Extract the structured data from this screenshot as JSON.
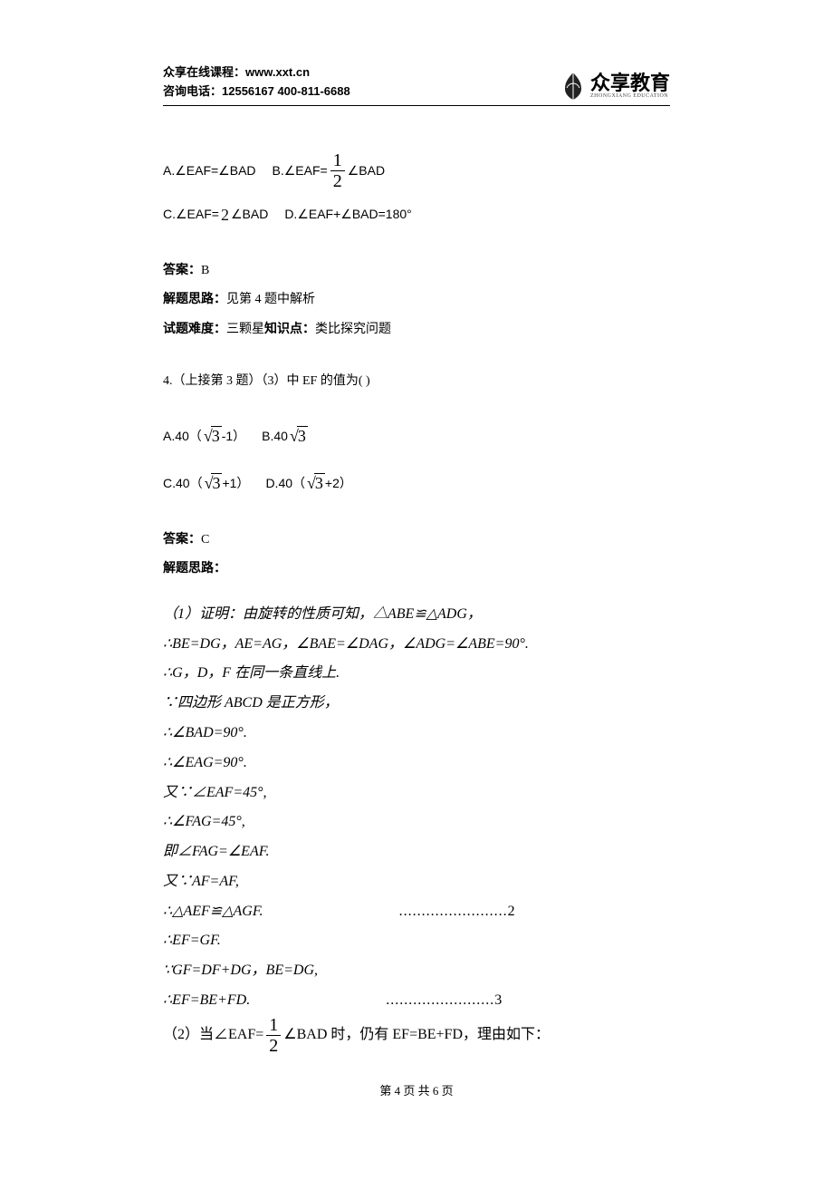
{
  "header": {
    "line1": "众享在线课程：www.xxt.cn",
    "line2": "咨询电话：12556167  400-811-6688",
    "logo_main": "众享教育",
    "logo_sub": "ZHONGXIANG  EDUCATION"
  },
  "q3": {
    "optA_pre": "A.∠EAF=∠BAD",
    "optB_pre": "B.∠EAF=",
    "optB_frac_num": "1",
    "optB_frac_den": "2",
    "optB_post": "∠BAD",
    "optC_pre": "C.∠EAF=",
    "optC_sup": "2",
    "optC_post": "∠BAD",
    "optD": "D.∠EAF+∠BAD=180°",
    "ans_label": "答案：",
    "ans_val": "B",
    "route_label": "解题思路：",
    "route_text": "见第 4 题中解析",
    "diff_label": "试题难度：",
    "diff_text": "三颗星",
    "kp_label": "知识点：",
    "kp_text": "类比探究问题"
  },
  "q4": {
    "stem": "4.（上接第 3 题）（3）中 EF 的值为(      )",
    "A_pre": "A.40（",
    "A_rad": "3",
    "A_post": "-1）",
    "B_pre": "B.40",
    "B_rad": "3",
    "C_pre": "C.40（",
    "C_rad": "3",
    "C_post": "+1）",
    "D_pre": "D.40（",
    "D_rad": "3",
    "D_post": "+2）",
    "ans_label": "答案：",
    "ans_val": "C",
    "route_label": "解题思路："
  },
  "proof": {
    "p1": "（1）证明：由旋转的性质可知，△ABE≌△ADG，",
    "p2": "∴BE=DG，AE=AG，∠BAE=∠DAG，∠ADG=∠ABE=90°.",
    "p3": "∴G，D，F 在同一条直线上.",
    "p4": "∵四边形 ABCD 是正方形，",
    "p5": "∴∠BAD=90°.",
    "p6": "∴∠EAG=90°.",
    "p7": "又∵∠EAF=45°,",
    "p8": "∴∠FAG=45°,",
    "p9": "即∠FAG=∠EAF.",
    "p10": "又∵AF=AF,",
    "p11a": "∴△AEF≌△AGF.",
    "p11b": "........................2",
    "p12": "∴EF=GF.",
    "p13": "∵GF=DF+DG，BE=DG,",
    "p14a": "∴EF=BE+FD.",
    "p14b": "........................3",
    "p15_pre": "（2）当∠EAF=",
    "p15_num": "1",
    "p15_den": "2",
    "p15_post": "∠BAD 时，仍有 EF=BE+FD，理由如下："
  },
  "footer": "第 4 页 共 6 页"
}
